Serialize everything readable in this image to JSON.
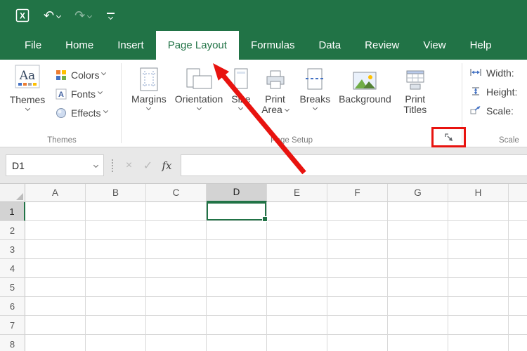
{
  "colors": {
    "excel_green": "#217346",
    "selection_green": "#217346",
    "annotation_red": "#e8130f",
    "gridline": "#d9d9d9"
  },
  "icons": {
    "undo": "↶",
    "redo": "↷",
    "customize_quick_access": "bar-with-chevron",
    "name_box_dropdown": "chevron-down",
    "cancel": "×",
    "enter": "✓",
    "dialog_launcher": "diagonal-arrow-southeast",
    "select_all": "corner-triangle"
  },
  "ribbon_tabs": [
    {
      "label": "File",
      "selected": false
    },
    {
      "label": "Home",
      "selected": false
    },
    {
      "label": "Insert",
      "selected": false
    },
    {
      "label": "Page Layout",
      "selected": true
    },
    {
      "label": "Formulas",
      "selected": false
    },
    {
      "label": "Data",
      "selected": false
    },
    {
      "label": "Review",
      "selected": false
    },
    {
      "label": "View",
      "selected": false
    },
    {
      "label": "Help",
      "selected": false
    }
  ],
  "ribbon": {
    "themes_group": {
      "group_label": "Themes",
      "themes_button": "Themes",
      "themes_icon_text": "Aa",
      "colors_button": "Colors",
      "fonts_button": "Fonts",
      "effects_button": "Effects"
    },
    "page_setup_group": {
      "group_label": "Page Setup",
      "margins_button": "Margins",
      "orientation_button": "Orientation",
      "size_button": "Size",
      "print_area_button": "Print Area",
      "breaks_button": "Breaks",
      "background_button": "Background",
      "print_titles_button": "Print Titles"
    },
    "scale_group": {
      "group_label": "Scale",
      "width_label": "Width:",
      "height_label": "Height:",
      "scale_label": "Scale:"
    }
  },
  "formula_bar": {
    "name_box_value": "D1",
    "insert_function_label": "fx",
    "formula_value": ""
  },
  "grid": {
    "columns": [
      "A",
      "B",
      "C",
      "D",
      "E",
      "F",
      "G",
      "H"
    ],
    "rows": [
      "1",
      "2",
      "3",
      "4",
      "5",
      "6",
      "7",
      "8"
    ],
    "active_cell": "D1",
    "active_column": "D",
    "active_row": "1"
  }
}
